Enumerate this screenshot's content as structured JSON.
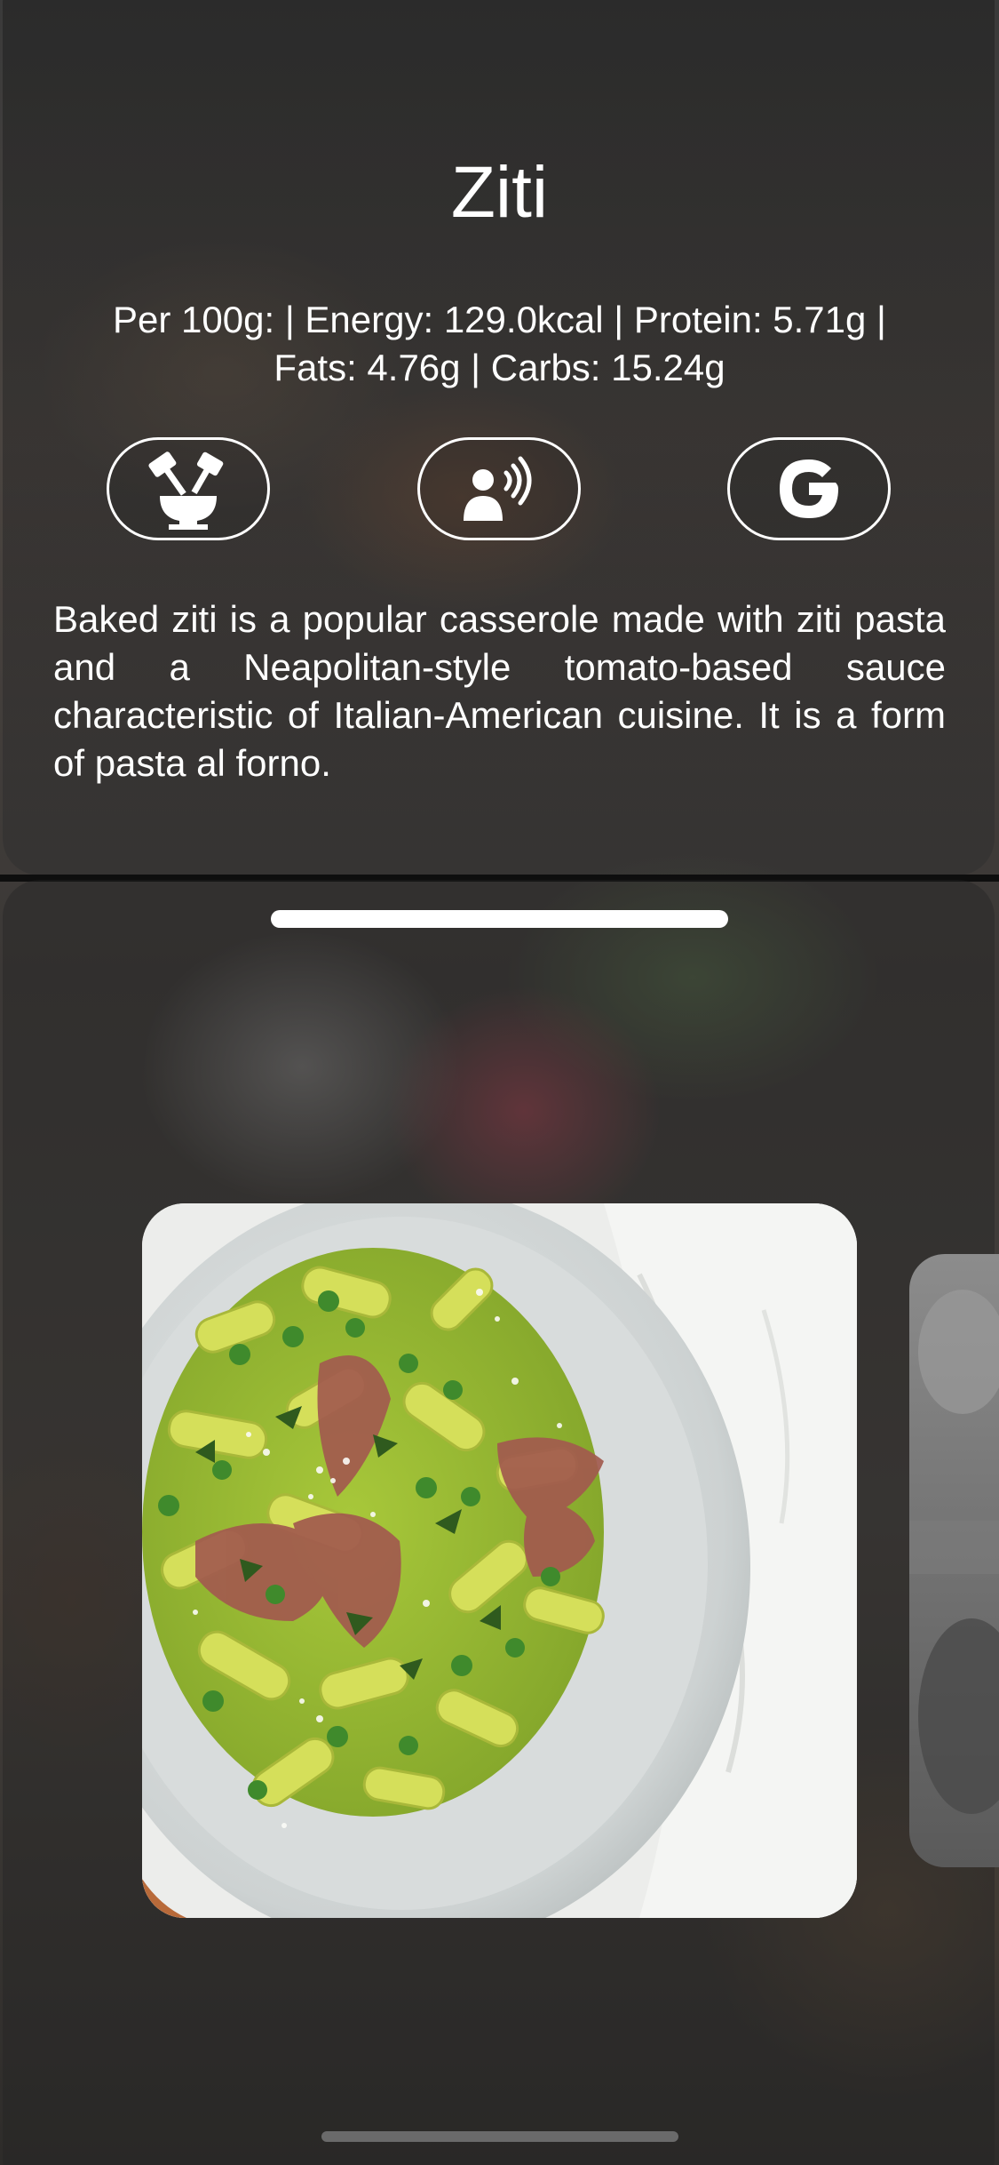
{
  "food": {
    "title": "Ziti",
    "nutrition_line1": "Per 100g: | Energy: 129.0kcal | Protein: 5.71g |",
    "nutrition_line2": "Fats: 4.76g | Carbs: 15.24g",
    "description": "Baked ziti is a popular casserole made with ziti pasta and a Neapolitan-style tomato-based sauce characteristic of Italian-American cuisine. It is a form of pasta al forno."
  },
  "actions": [
    {
      "icon": "mortar-pestle-icon"
    },
    {
      "icon": "speaker-voice-icon"
    },
    {
      "icon": "google-icon"
    }
  ],
  "gallery": {
    "images": [
      {
        "icon": "pasta-dish-image"
      },
      {
        "icon": "next-image"
      }
    ]
  },
  "colors": {
    "text": "#ffffff",
    "panel": "#2a2a2a",
    "plate": "#d9dcdc",
    "pasta": "#c8d85a"
  }
}
